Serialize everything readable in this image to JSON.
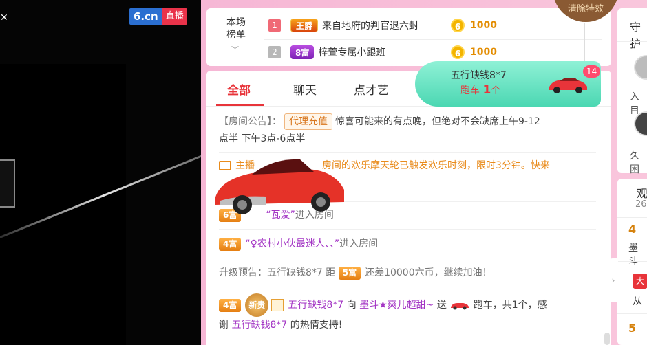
{
  "video": {
    "logo_main": "6.cn",
    "logo_tag": "直播"
  },
  "hang_button": {
    "label": "清除特效"
  },
  "rank": {
    "title_line1": "本场",
    "title_line2": "榜单",
    "rows": [
      {
        "rank": "1",
        "badge": "王爵",
        "name": "来自地府的判官退六封",
        "coin_icon": "6",
        "amount": "1000"
      },
      {
        "rank": "2",
        "badge": "8富",
        "name": "梓萱专属小跟班",
        "coin_icon": "6",
        "amount": "1000"
      }
    ]
  },
  "tabs": [
    {
      "label": "全部"
    },
    {
      "label": "聊天"
    },
    {
      "label": "点才艺"
    }
  ],
  "gift_pop": {
    "name": "五行缺钱8*7",
    "gift": "跑车",
    "count": "1",
    "unit": "个",
    "badge_count": "14"
  },
  "messages": {
    "announce_prefix": "【房间公告】：",
    "announce_btn": "代理充值",
    "announce_text": "惊喜可能来的有点晚，但绝对不会缺席上午9-12",
    "announce_text2": "点半 下午3点-6点半",
    "system_lead": "主播",
    "system_text": "房间的欢乐摩天轮已触发欢乐时刻，限时3分钟。快来",
    "enter1_level": "6富",
    "enter1_user": "“瓦爱”",
    "enter1_text": "进入房间",
    "enter2_level": "4富",
    "enter2_user": "“♀农村小伙最迷人、、”",
    "enter2_text": "进入房间",
    "upgrade_prefix": "升级预告：五行缺钱8*7 距",
    "upgrade_level": "5富",
    "upgrade_text": "还差10000六币，继续加油！",
    "gift_level": "4富",
    "gift_newbie": "新贵",
    "gift_user": "五行缺钱8*7",
    "gift_to": "向",
    "gift_target": "墨斗★爽儿超甜~",
    "gift_send": "送",
    "gift_text": "跑车，共1个，感",
    "gift_thanks_pre": "谢",
    "gift_thanks_user": "五行缺钱8*7",
    "gift_thanks_post": "的热情支持!"
  },
  "right": {
    "guard_title": "守护",
    "guard1": "入目",
    "guard2": "久困",
    "watch_title": "观",
    "watch_count": "26",
    "row1_level": "4",
    "row1_name": "墨斗",
    "row2_badge": "大",
    "row2_name": "从",
    "row3_level": "5"
  },
  "colors": {
    "accent": "#e8343a",
    "gold": "#e38c00",
    "pink_bg": "#f7a8cf"
  }
}
